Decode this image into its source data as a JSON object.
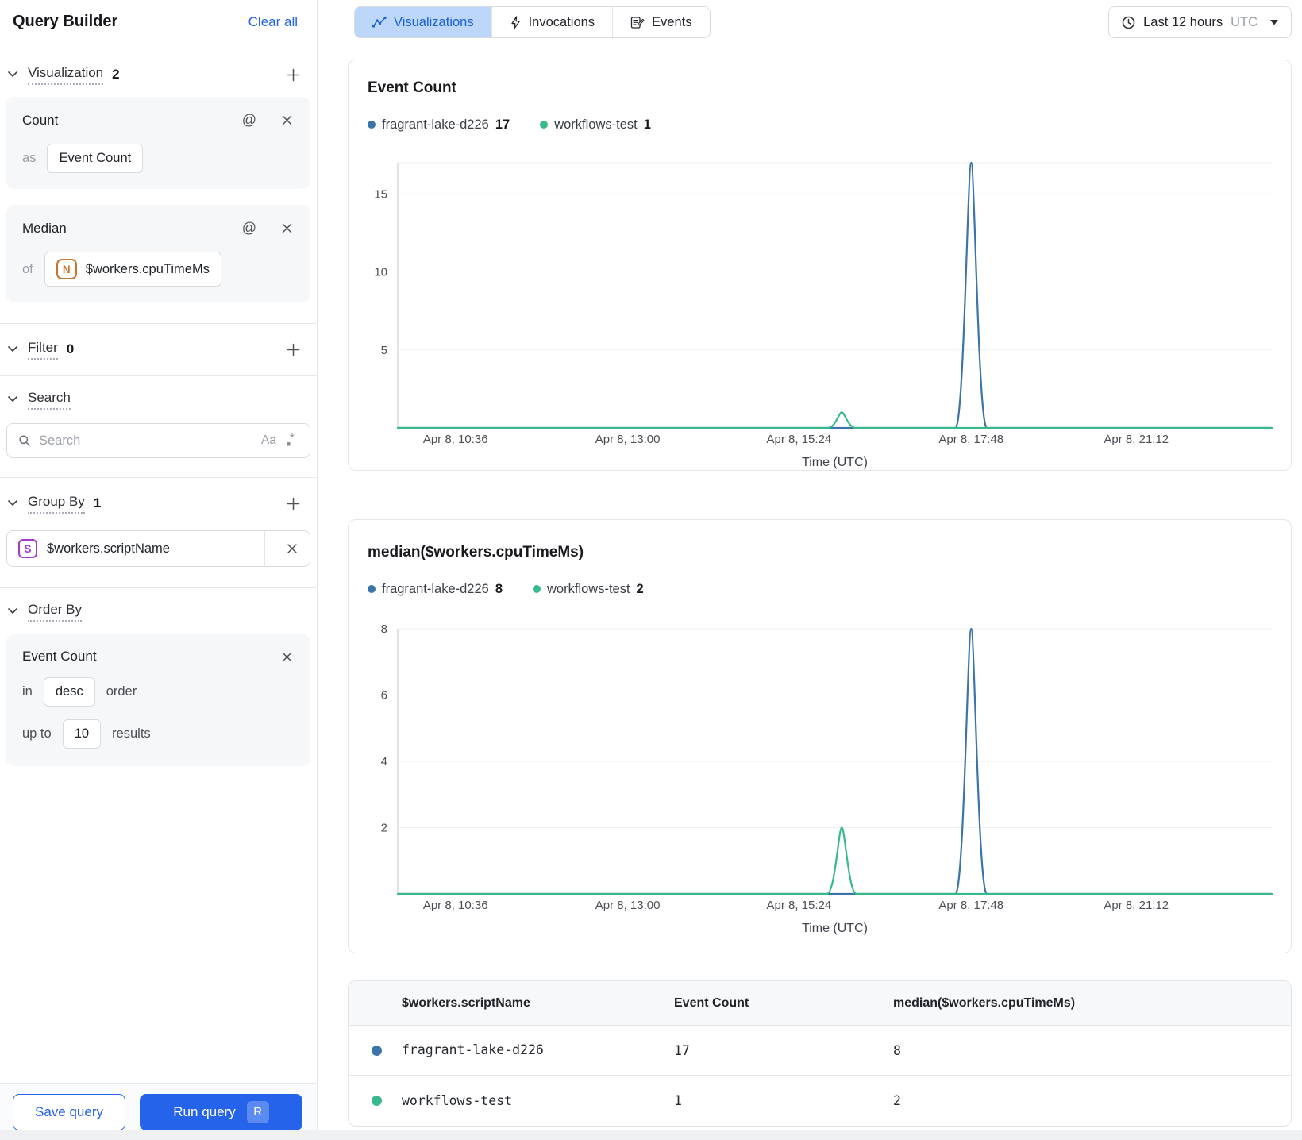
{
  "accent_color": "#2563eb",
  "series_colors": {
    "blue": "#3b74a8",
    "green": "#37b98c"
  },
  "sidebar": {
    "title": "Query Builder",
    "clear_all": "Clear all",
    "visualization": {
      "label": "Visualization",
      "count": "2",
      "cards": [
        {
          "title": "Count",
          "prefix": "as",
          "value": "Event Count"
        },
        {
          "title": "Median",
          "prefix": "of",
          "field_icon": "N",
          "value": "$workers.cpuTimeMs"
        }
      ]
    },
    "filter": {
      "label": "Filter",
      "count": "0"
    },
    "search": {
      "label": "Search",
      "placeholder": "Search",
      "case_icon_label": "Aa",
      "regex_icon": "dot-star"
    },
    "group_by": {
      "label": "Group By",
      "count": "1",
      "items": [
        {
          "icon": "S",
          "value": "$workers.scriptName"
        }
      ]
    },
    "order_by": {
      "label": "Order By",
      "card": {
        "title": "Event Count",
        "in_label": "in",
        "direction": "desc",
        "order_label": "order",
        "up_to_label": "up to",
        "limit": "10",
        "results_label": "results"
      }
    },
    "save_button": "Save query",
    "run_button": "Run query",
    "run_shortcut": "R"
  },
  "toolbar": {
    "tabs": [
      {
        "label": "Visualizations",
        "icon": "line-chart",
        "active": true
      },
      {
        "label": "Invocations",
        "icon": "lightning-bolt",
        "active": false
      },
      {
        "label": "Events",
        "icon": "form-pencil",
        "active": false
      }
    ],
    "time_range": {
      "icon": "clock",
      "label": "Last 12 hours",
      "timezone": "UTC"
    }
  },
  "chart_data": [
    {
      "type": "line",
      "title": "Event Count",
      "xlabel": "Time (UTC)",
      "x_ticks": [
        "Apr 8, 10:36",
        "Apr 8, 13:00",
        "Apr 8, 15:24",
        "Apr 8, 17:48",
        "Apr 8, 21:12"
      ],
      "x_tick_fracs": [
        0.066,
        0.263,
        0.459,
        0.656,
        0.845
      ],
      "y_ticks": [
        5,
        10,
        15
      ],
      "ylim": [
        0,
        17
      ],
      "grid": true,
      "legend_position": "top",
      "legend": [
        {
          "name": "fragrant-lake-d226",
          "value": 17,
          "color": "#3b74a8"
        },
        {
          "name": "workflows-test",
          "value": 1,
          "color": "#37b98c"
        }
      ],
      "series": [
        {
          "name": "fragrant-lake-d226",
          "color": "#3b74a8",
          "baseline": 0,
          "peaks": [
            {
              "x_frac": 0.656,
              "value": 17,
              "half_width_frac": 0.018
            }
          ]
        },
        {
          "name": "workflows-test",
          "color": "#37b98c",
          "baseline": 0,
          "peaks": [
            {
              "x_frac": 0.508,
              "value": 1,
              "half_width_frac": 0.016
            }
          ]
        }
      ]
    },
    {
      "type": "line",
      "title": "median($workers.cpuTimeMs)",
      "xlabel": "Time (UTC)",
      "x_ticks": [
        "Apr 8, 10:36",
        "Apr 8, 13:00",
        "Apr 8, 15:24",
        "Apr 8, 17:48",
        "Apr 8, 21:12"
      ],
      "x_tick_fracs": [
        0.066,
        0.263,
        0.459,
        0.656,
        0.845
      ],
      "y_ticks": [
        2,
        4,
        6,
        8
      ],
      "ylim": [
        0,
        8
      ],
      "grid": true,
      "legend_position": "top",
      "legend": [
        {
          "name": "fragrant-lake-d226",
          "value": 8,
          "color": "#3b74a8"
        },
        {
          "name": "workflows-test",
          "value": 2,
          "color": "#37b98c"
        }
      ],
      "series": [
        {
          "name": "fragrant-lake-d226",
          "color": "#3b74a8",
          "baseline": 0,
          "peaks": [
            {
              "x_frac": 0.656,
              "value": 8,
              "half_width_frac": 0.018
            }
          ]
        },
        {
          "name": "workflows-test",
          "color": "#37b98c",
          "baseline": 0,
          "peaks": [
            {
              "x_frac": 0.508,
              "value": 2,
              "half_width_frac": 0.017
            }
          ]
        }
      ]
    }
  ],
  "table": {
    "headers": [
      "$workers.scriptName",
      "Event Count",
      "median($workers.cpuTimeMs)"
    ],
    "rows": [
      {
        "color": "#3b74a8",
        "name": "fragrant-lake-d226",
        "event_count": "17",
        "median": "8"
      },
      {
        "color": "#37b98c",
        "name": "workflows-test",
        "event_count": "1",
        "median": "2"
      }
    ]
  }
}
